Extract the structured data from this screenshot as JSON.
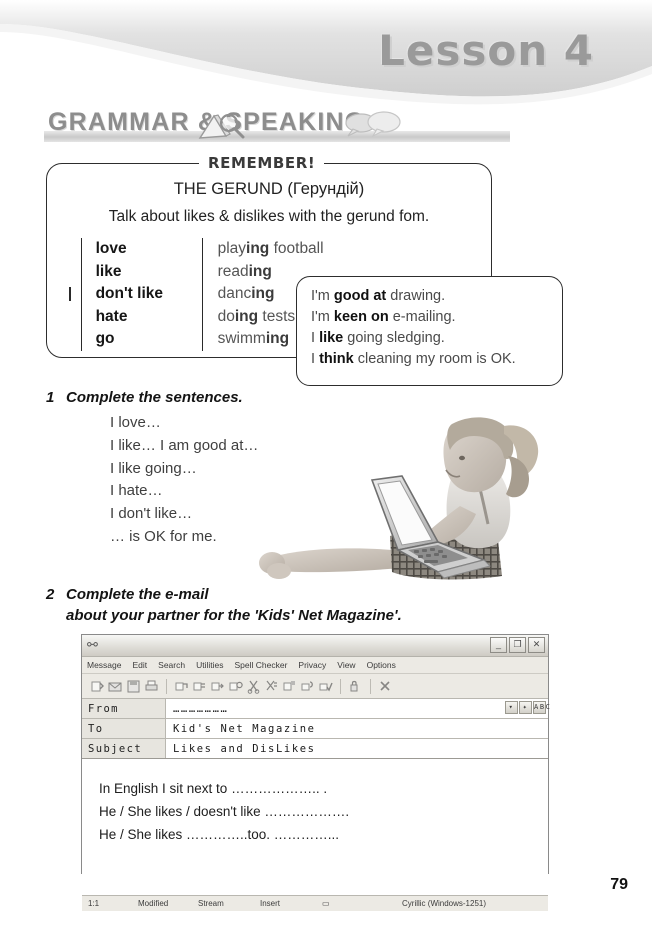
{
  "banner": {
    "lesson_title": "Lesson 4"
  },
  "section": {
    "title": "GRAMMAR  &  SPEAKING",
    "icons": [
      "open-book-icon",
      "magnifier-icon",
      "speech-bubbles-icon"
    ]
  },
  "remember": {
    "tab_label": "REMEMBER!",
    "heading": "THE GERUND (Герундій)",
    "subheading": "Talk about likes & dislikes with the gerund fom.",
    "left_marker": "I",
    "verbs": [
      "love",
      "like",
      "don't like",
      "hate",
      "go"
    ],
    "gerunds": [
      {
        "stem": "play",
        "ing": "ing",
        "tail": " football"
      },
      {
        "stem": "read",
        "ing": "ing",
        "tail": ""
      },
      {
        "stem": "danc",
        "ing": "ing",
        "tail": ""
      },
      {
        "stem": "do",
        "ing": "ing",
        "tail": " tests"
      },
      {
        "stem": "swimm",
        "ing": "ing",
        "tail": ""
      }
    ]
  },
  "examples": [
    {
      "pre": "I'm ",
      "bold": "good at",
      "post": " drawing."
    },
    {
      "pre": "I'm ",
      "bold": "keen on",
      "post": " e-mailing."
    },
    {
      "pre": "I ",
      "bold": "like",
      "post": " going sledging."
    },
    {
      "pre": "I ",
      "bold": "think",
      "post": " cleaning my room is OK."
    }
  ],
  "exercise1": {
    "number": "1",
    "title": "Complete the sentences.",
    "lines": [
      "I love…",
      "I like… I am good at…",
      "I like going…",
      "I hate…",
      "I don't like…",
      "… is OK for me."
    ]
  },
  "exercise2": {
    "number": "2",
    "line1": "Complete the e-mail",
    "line2": "about your partner for the 'Kids' Net Magazine'."
  },
  "photo": {
    "alt": "girl-with-laptop-photo"
  },
  "mail_window": {
    "title": "",
    "window_buttons": [
      "_",
      "❐",
      "✕"
    ],
    "menu": [
      "Message",
      "Edit",
      "Search",
      "Utilities",
      "Spell Checker",
      "Privacy",
      "View",
      "Options"
    ],
    "toolbar_icons": [
      "new-message-icon",
      "open-mail-icon",
      "save-mail-icon",
      "print-icon",
      "reply-icon",
      "reply-all-icon",
      "forward-icon",
      "send-icon",
      "cut-icon",
      "copy-icon",
      "paste-icon",
      "attach-icon",
      "spell-icon",
      "encrypt-icon",
      "delete-icon"
    ],
    "fields": [
      {
        "label": "From",
        "value": "…………………"
      },
      {
        "label": "To",
        "value": "Kid's Net Magazine"
      },
      {
        "label": "Subject",
        "value": "Likes and DisLikes"
      }
    ],
    "field_buttons": [
      "▾",
      "✦",
      "ABC"
    ],
    "body_lines": [
      "In English I sit next to ……………….. .",
      "He / She likes / doesn't like ……………….",
      "He / She likes …………..too. …………..."
    ],
    "status": {
      "position": "1:1",
      "modified": "Modified",
      "mode": "Stream",
      "insert": "Insert",
      "icon": "overwrite-icon",
      "encoding": "Cyrillic (Windows-1251)"
    }
  },
  "page_number": "79"
}
